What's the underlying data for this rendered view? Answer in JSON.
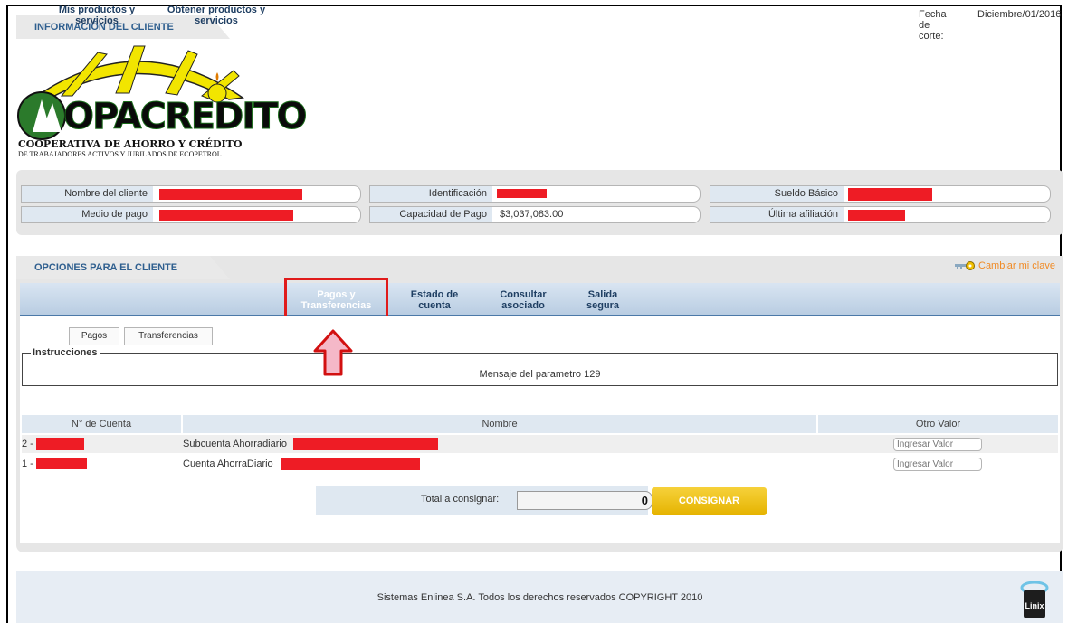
{
  "header": {
    "client_info_title": "INFORMACIÓN DEL CLIENTE",
    "cutoff_label": "Fecha de corte:",
    "cutoff_date": "Diciembre/01/2016"
  },
  "logo": {
    "name": "OPACREDITO",
    "line1": "COOPERATIVA DE AHORRO Y CRÉDITO",
    "line2": "DE TRABAJADORES ACTIVOS Y JUBILADOS DE ECOPETROL"
  },
  "client_fields": {
    "name_label": "Nombre del cliente",
    "payment_method_label": "Medio de pago",
    "id_label": "Identificación",
    "capacity_label": "Capacidad de Pago",
    "capacity_value": "$3,037,083.00",
    "salary_label": "Sueldo Básico",
    "last_affiliation_label": "Última afiliación"
  },
  "options": {
    "title": "OPCIONES PARA EL CLIENTE",
    "change_password": "Cambiar mi clave"
  },
  "menu": {
    "items": [
      {
        "line1": "Mis productos y",
        "line2": "servicios"
      },
      {
        "line1": "Obtener productos y",
        "line2": "servicios"
      },
      {
        "line1": "Pagos y",
        "line2": "Transferencias"
      },
      {
        "line1": "Estado de",
        "line2": "cuenta"
      },
      {
        "line1": "Consultar",
        "line2": "asociado"
      },
      {
        "line1": "Salida",
        "line2": "segura"
      }
    ]
  },
  "subtabs": [
    "Pagos",
    "Transferencias"
  ],
  "instructions": {
    "legend": "Instrucciones",
    "message": "Mensaje del parametro 129"
  },
  "table": {
    "headers": [
      "N° de Cuenta",
      "Nombre",
      "Otro Valor"
    ],
    "rows": [
      {
        "account_prefix": "2 -",
        "name": "Subcuenta Ahorradiario",
        "placeholder": "Ingresar Valor"
      },
      {
        "account_prefix": "1 -",
        "name": "Cuenta AhorraDiario",
        "placeholder": "Ingresar Valor"
      }
    ]
  },
  "total": {
    "label": "Total a consignar:",
    "value": "0",
    "button": "CONSIGNAR"
  },
  "footer": {
    "text": "Sistemas Enlinea S.A. Todos los derechos reservados COPYRIGHT 2010",
    "brand": "Linix"
  },
  "colors": {
    "redaction": "#ee1c25",
    "accent_blue": "#2f5f8f",
    "button_yellow": "#e5b300",
    "highlight_red": "#e01b1b",
    "link_orange": "#f08a24"
  }
}
